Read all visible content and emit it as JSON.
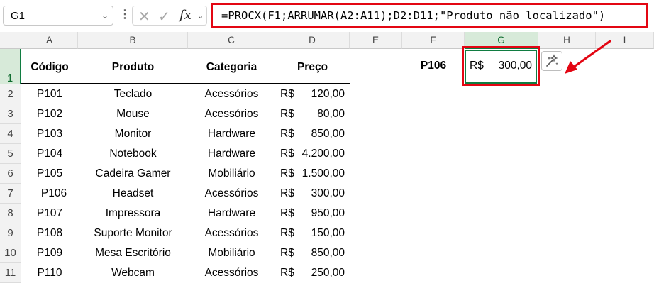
{
  "formula_bar": {
    "name_box": "G1",
    "formula": "=PROCX(F1;ARRUMAR(A2:A11);D2:D11;\"Produto não localizado\")",
    "icons": [
      "cancel-icon",
      "enter-icon",
      "function-icon"
    ]
  },
  "columns": [
    "A",
    "B",
    "C",
    "D",
    "E",
    "F",
    "G",
    "H",
    "I"
  ],
  "rows": [
    "1",
    "2",
    "3",
    "4",
    "5",
    "6",
    "7",
    "8",
    "9",
    "10",
    "11"
  ],
  "table": {
    "headers": [
      "Código",
      "Produto",
      "Categoria",
      "Preço"
    ],
    "currency": "R$",
    "records": [
      {
        "code": "P101",
        "product": "Teclado",
        "category": "Acessórios",
        "price": "120,00"
      },
      {
        "code": "P102",
        "product": "Mouse",
        "category": "Acessórios",
        "price": "80,00"
      },
      {
        "code": "P103",
        "product": "Monitor",
        "category": "Hardware",
        "price": "850,00"
      },
      {
        "code": "P104",
        "product": "Notebook",
        "category": "Hardware",
        "price": "4.200,00"
      },
      {
        "code": "P105",
        "product": "Cadeira Gamer",
        "category": "Mobiliário",
        "price": "1.500,00"
      },
      {
        "code": " P106",
        "product": "Headset",
        "category": "Acessórios",
        "price": "300,00"
      },
      {
        "code": "P107",
        "product": "Impressora",
        "category": "Hardware",
        "price": "950,00"
      },
      {
        "code": "P108",
        "product": "Suporte Monitor",
        "category": "Acessórios",
        "price": "150,00"
      },
      {
        "code": "P109",
        "product": "Mesa Escritório",
        "category": "Mobiliário",
        "price": "850,00"
      },
      {
        "code": "P110",
        "product": "Webcam",
        "category": "Acessórios",
        "price": "250,00"
      }
    ]
  },
  "lookup": {
    "key": "P106",
    "result_currency": "R$",
    "result_value": "300,00"
  },
  "colors": {
    "highlight": "#e30613",
    "selection": "#107c41"
  },
  "quick_analysis_icon": "sparkle-icon"
}
